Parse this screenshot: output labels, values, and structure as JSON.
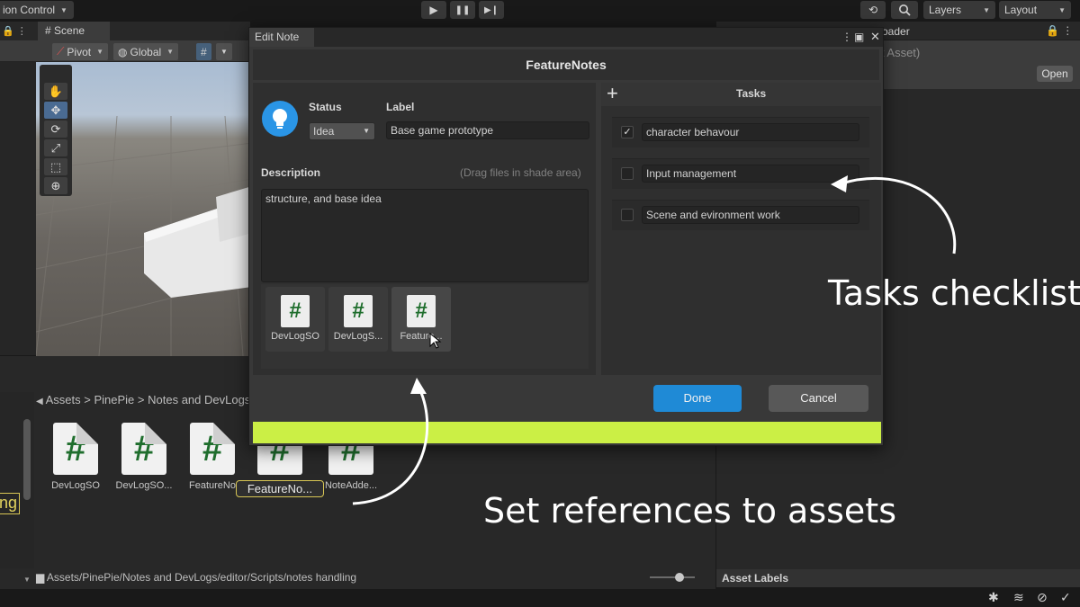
{
  "topbar": {
    "version_control": "ion Control",
    "layers": "Layers",
    "layout": "Layout",
    "play_icon": "play-icon",
    "pause_icon": "pause-icon",
    "step_icon": "step-icon"
  },
  "scene": {
    "tab_label": "Scene",
    "pivot": "Pivot",
    "global": "Global"
  },
  "project": {
    "breadcrumb": [
      "Assets",
      "PinePie",
      "Notes and DevLogs"
    ],
    "assets": [
      "DevLogSO",
      "DevLogSO...",
      "FeatureNo",
      "FeatureNo...",
      "NoteAdde..."
    ],
    "path": "Assets/PinePie/Notes and DevLogs/editor/Scripts/notes handling",
    "left_cut_label": "ng"
  },
  "right_panel": {
    "title": "oader",
    "subtitle": "lt Asset)",
    "open_label": "Open",
    "asset_labels": "Asset Labels"
  },
  "dialog": {
    "tab_label": "Edit Note",
    "header": "FeatureNotes",
    "status_label": "Status",
    "status_value": "Idea",
    "label_label": "Label",
    "label_value": "Base game prototype",
    "description_label": "Description",
    "description_hint": "(Drag files in shade area)",
    "description_value": "structure, and base idea",
    "references": [
      "DevLogSO",
      "DevLogS...",
      "Feature..."
    ],
    "tasks_title": "Tasks",
    "tasks": [
      {
        "label": "character behavour",
        "checked": true
      },
      {
        "label": "Input management",
        "checked": false
      },
      {
        "label": "Scene and evironment work",
        "checked": false
      }
    ],
    "done_label": "Done",
    "cancel_label": "Cancel",
    "accent_done": "#1f8ad6",
    "progress_color": "#cbef45"
  },
  "annotations": {
    "tasks_caption": "Tasks checklist",
    "refs_caption": "Set references to assets"
  }
}
